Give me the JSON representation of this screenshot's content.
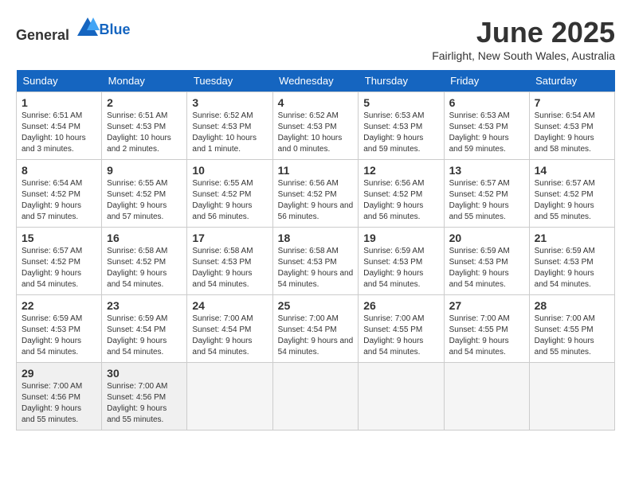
{
  "header": {
    "logo_general": "General",
    "logo_blue": "Blue",
    "month_year": "June 2025",
    "location": "Fairlight, New South Wales, Australia"
  },
  "days_of_week": [
    "Sunday",
    "Monday",
    "Tuesday",
    "Wednesday",
    "Thursday",
    "Friday",
    "Saturday"
  ],
  "weeks": [
    [
      {
        "day": "1",
        "sunrise": "6:51 AM",
        "sunset": "4:54 PM",
        "daylight": "10 hours and 3 minutes."
      },
      {
        "day": "2",
        "sunrise": "6:51 AM",
        "sunset": "4:53 PM",
        "daylight": "10 hours and 2 minutes."
      },
      {
        "day": "3",
        "sunrise": "6:52 AM",
        "sunset": "4:53 PM",
        "daylight": "10 hours and 1 minute."
      },
      {
        "day": "4",
        "sunrise": "6:52 AM",
        "sunset": "4:53 PM",
        "daylight": "10 hours and 0 minutes."
      },
      {
        "day": "5",
        "sunrise": "6:53 AM",
        "sunset": "4:53 PM",
        "daylight": "9 hours and 59 minutes."
      },
      {
        "day": "6",
        "sunrise": "6:53 AM",
        "sunset": "4:53 PM",
        "daylight": "9 hours and 59 minutes."
      },
      {
        "day": "7",
        "sunrise": "6:54 AM",
        "sunset": "4:53 PM",
        "daylight": "9 hours and 58 minutes."
      }
    ],
    [
      {
        "day": "8",
        "sunrise": "6:54 AM",
        "sunset": "4:52 PM",
        "daylight": "9 hours and 57 minutes."
      },
      {
        "day": "9",
        "sunrise": "6:55 AM",
        "sunset": "4:52 PM",
        "daylight": "9 hours and 57 minutes."
      },
      {
        "day": "10",
        "sunrise": "6:55 AM",
        "sunset": "4:52 PM",
        "daylight": "9 hours and 56 minutes."
      },
      {
        "day": "11",
        "sunrise": "6:56 AM",
        "sunset": "4:52 PM",
        "daylight": "9 hours and 56 minutes."
      },
      {
        "day": "12",
        "sunrise": "6:56 AM",
        "sunset": "4:52 PM",
        "daylight": "9 hours and 56 minutes."
      },
      {
        "day": "13",
        "sunrise": "6:57 AM",
        "sunset": "4:52 PM",
        "daylight": "9 hours and 55 minutes."
      },
      {
        "day": "14",
        "sunrise": "6:57 AM",
        "sunset": "4:52 PM",
        "daylight": "9 hours and 55 minutes."
      }
    ],
    [
      {
        "day": "15",
        "sunrise": "6:57 AM",
        "sunset": "4:52 PM",
        "daylight": "9 hours and 54 minutes."
      },
      {
        "day": "16",
        "sunrise": "6:58 AM",
        "sunset": "4:52 PM",
        "daylight": "9 hours and 54 minutes."
      },
      {
        "day": "17",
        "sunrise": "6:58 AM",
        "sunset": "4:53 PM",
        "daylight": "9 hours and 54 minutes."
      },
      {
        "day": "18",
        "sunrise": "6:58 AM",
        "sunset": "4:53 PM",
        "daylight": "9 hours and 54 minutes."
      },
      {
        "day": "19",
        "sunrise": "6:59 AM",
        "sunset": "4:53 PM",
        "daylight": "9 hours and 54 minutes."
      },
      {
        "day": "20",
        "sunrise": "6:59 AM",
        "sunset": "4:53 PM",
        "daylight": "9 hours and 54 minutes."
      },
      {
        "day": "21",
        "sunrise": "6:59 AM",
        "sunset": "4:53 PM",
        "daylight": "9 hours and 54 minutes."
      }
    ],
    [
      {
        "day": "22",
        "sunrise": "6:59 AM",
        "sunset": "4:53 PM",
        "daylight": "9 hours and 54 minutes."
      },
      {
        "day": "23",
        "sunrise": "6:59 AM",
        "sunset": "4:54 PM",
        "daylight": "9 hours and 54 minutes."
      },
      {
        "day": "24",
        "sunrise": "7:00 AM",
        "sunset": "4:54 PM",
        "daylight": "9 hours and 54 minutes."
      },
      {
        "day": "25",
        "sunrise": "7:00 AM",
        "sunset": "4:54 PM",
        "daylight": "9 hours and 54 minutes."
      },
      {
        "day": "26",
        "sunrise": "7:00 AM",
        "sunset": "4:55 PM",
        "daylight": "9 hours and 54 minutes."
      },
      {
        "day": "27",
        "sunrise": "7:00 AM",
        "sunset": "4:55 PM",
        "daylight": "9 hours and 54 minutes."
      },
      {
        "day": "28",
        "sunrise": "7:00 AM",
        "sunset": "4:55 PM",
        "daylight": "9 hours and 55 minutes."
      }
    ],
    [
      {
        "day": "29",
        "sunrise": "7:00 AM",
        "sunset": "4:56 PM",
        "daylight": "9 hours and 55 minutes."
      },
      {
        "day": "30",
        "sunrise": "7:00 AM",
        "sunset": "4:56 PM",
        "daylight": "9 hours and 55 minutes."
      },
      null,
      null,
      null,
      null,
      null
    ]
  ]
}
